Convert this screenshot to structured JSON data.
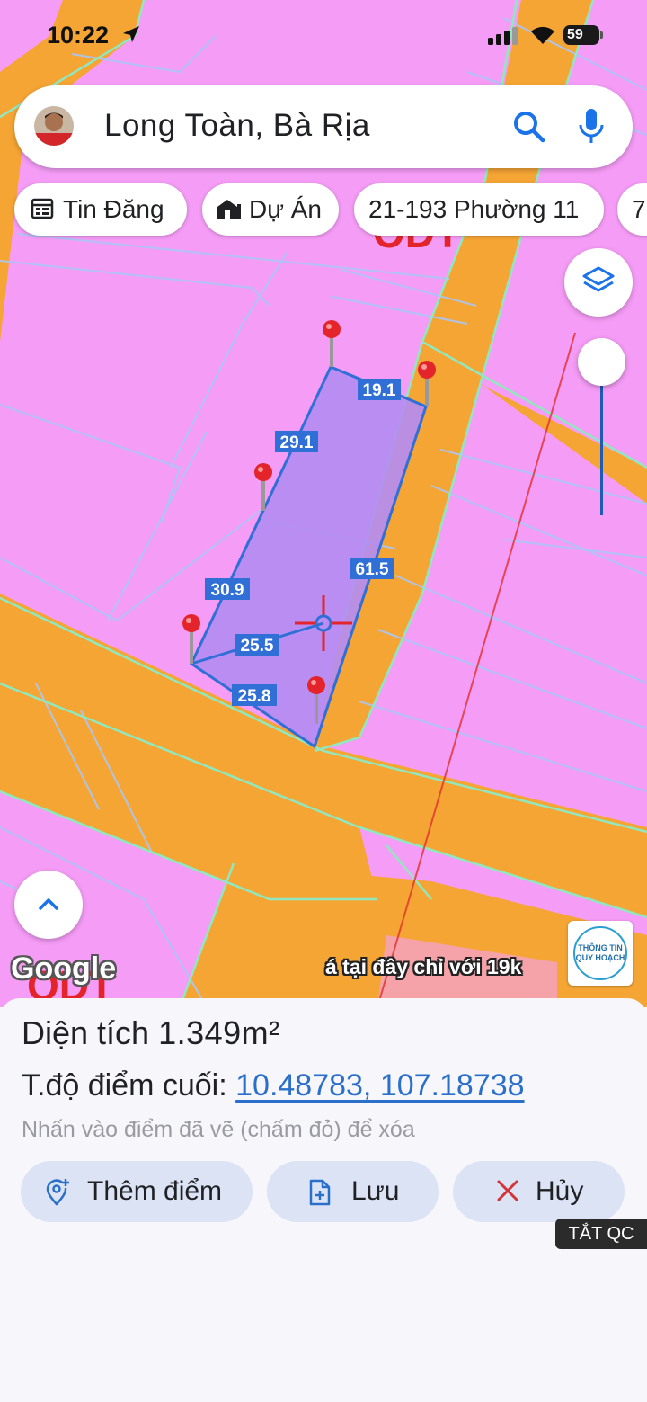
{
  "status_bar": {
    "time": "10:22",
    "battery": "59"
  },
  "search": {
    "query": "Long Toàn, Bà Rịa",
    "icons": [
      "avatar",
      "search-icon",
      "mic-icon"
    ]
  },
  "chips": [
    {
      "label": "Tin Đăng",
      "icon": "calendar-icon"
    },
    {
      "label": "Dự Án",
      "icon": "building-icon"
    },
    {
      "label": "21-193 Phường 11",
      "icon": ""
    },
    {
      "label": "7",
      "icon": ""
    }
  ],
  "map": {
    "zone_label_top": "ODT",
    "zone_label_bottom": "ODT",
    "edge_labels": [
      "19.1",
      "29.1",
      "30.9",
      "61.5",
      "25.5",
      "25.8"
    ],
    "google_logo": "Google",
    "promo_text": "á tại đây chỉ với 19k",
    "badge_line1": "THÔNG TIN",
    "badge_line2": "QUY HOẠCH",
    "colors": {
      "land": "#f59cf6",
      "road": "#f5a534",
      "polygon_fill": "#b48cf3",
      "polygon_stroke": "#2f6fd6",
      "marker": "#e3252b"
    }
  },
  "sheet": {
    "area_label": "Diện tích",
    "area_value": "1.349m²",
    "coord_label": "T.độ điểm cuối:",
    "coord_value": "10.48783, 107.18738",
    "hint": "Nhấn vào điểm đã vẽ (chấm đỏ) để xóa",
    "buttons": {
      "add_point": "Thêm điểm",
      "save": "Lưu",
      "cancel": "Hủy"
    },
    "ads_off": "TẮT QC"
  }
}
